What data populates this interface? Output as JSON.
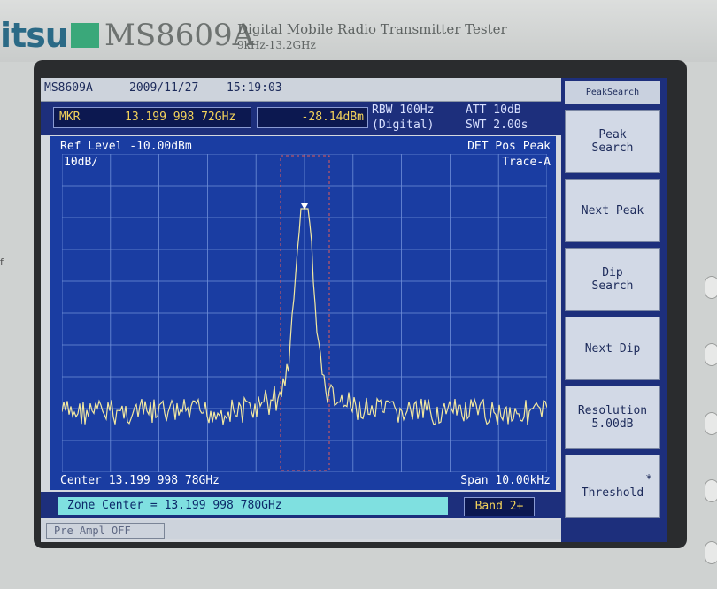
{
  "bezel": {
    "brand": "itsu",
    "model": "MS8609A",
    "subtitle": "Digital Mobile Radio Transmitter Tester",
    "range": "9kHz-13.2GHz",
    "side_mark": "f"
  },
  "header": {
    "model": "MS8609A",
    "date": "2009/11/27",
    "time": "15:19:03"
  },
  "marker": {
    "label": "MKR",
    "frequency": "13.199 998 72GHz",
    "level": "-28.14dBm",
    "rbw": "RBW 100Hz",
    "rbw_mode": "(Digital)",
    "att": "ATT 10dB",
    "swt": "SWT 2.00s"
  },
  "plot": {
    "ref_level": "Ref Level -10.00dBm",
    "scale": "10dB/",
    "detector": "DET  Pos Peak",
    "trace": "Trace-A",
    "center": "Center 13.199 998 78GHz",
    "span": "Span 10.00kHz"
  },
  "zone": {
    "center": "Zone Center = 13.199 998 780GHz",
    "band": "Band 2+"
  },
  "status": {
    "preamp": "Pre Ampl OFF"
  },
  "softkeys": {
    "title": "PeakSearch",
    "items": [
      {
        "line1": "Peak",
        "line2": "Search"
      },
      {
        "line1": "Next Peak",
        "line2": ""
      },
      {
        "line1": "Dip",
        "line2": "Search"
      },
      {
        "line1": "Next Dip",
        "line2": ""
      },
      {
        "line1": "Resolution",
        "line2": "5.00dB"
      },
      {
        "line1": "*",
        "line2": "Threshold"
      }
    ]
  },
  "colors": {
    "plot_bg": "#1a3da2",
    "trace": "#f2e8a0",
    "marker": "#f4d35a",
    "zone_bg": "#7fe0e0"
  }
}
